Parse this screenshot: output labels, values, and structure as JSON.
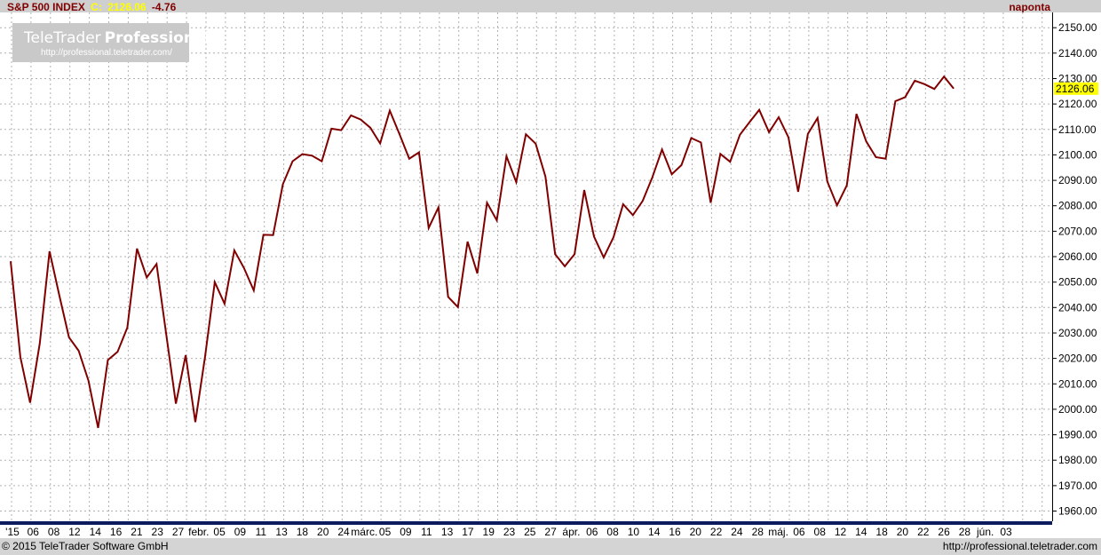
{
  "header": {
    "instrument": "S&P 500 INDEX",
    "close_label": "C:",
    "close_value": "2126.06",
    "change": "-4.76",
    "period": "naponta"
  },
  "watermark": {
    "brand_light": "TeleTrader",
    "brand_bold": "Professional",
    "url": "http://professional.teletrader.com/"
  },
  "footer": {
    "copyright": "© 2015 TeleTrader Software GmbH",
    "url": "http://professional.teletrader.com"
  },
  "colors": {
    "line": "#800000",
    "grid": "#b0b0b0",
    "axis_bar": "#0b1b5e",
    "current_bg": "#ffff00",
    "header_title": "#800000",
    "header_value": "#ffff00",
    "header_change": "#800000"
  },
  "chart_data": {
    "type": "line",
    "title": "S&P 500 INDEX",
    "current_value_label": "2126.06",
    "ylim": [
      1956,
      2156
    ],
    "yticks": [
      "1960.00",
      "1970.00",
      "1980.00",
      "1990.00",
      "2000.00",
      "2010.00",
      "2020.00",
      "2030.00",
      "2040.00",
      "2050.00",
      "2060.00",
      "2070.00",
      "2080.00",
      "2090.00",
      "2100.00",
      "2110.00",
      "2120.00",
      "2130.00",
      "2140.00",
      "2150.00"
    ],
    "x_tick_labels": [
      "'15",
      "06",
      "08",
      "12",
      "14",
      "16",
      "21",
      "23",
      "27",
      "febr.",
      "05",
      "09",
      "11",
      "13",
      "18",
      "20",
      "24",
      "márc.",
      "05",
      "09",
      "11",
      "13",
      "17",
      "19",
      "23",
      "25",
      "27",
      "ápr.",
      "06",
      "08",
      "10",
      "14",
      "16",
      "20",
      "22",
      "24",
      "28",
      "máj.",
      "06",
      "08",
      "12",
      "14",
      "18",
      "20",
      "22",
      "26",
      "28",
      "jún.",
      "03"
    ],
    "grid": true,
    "series": [
      {
        "values": [
          2058.2,
          2020.6,
          2002.6,
          2025.9,
          2062.1,
          2044.8,
          2028.3,
          2023.0,
          2011.3,
          1992.7,
          2019.4,
          2022.6,
          2032.1,
          2063.2,
          2051.8,
          2057.1,
          2029.5,
          2002.2,
          2021.3,
          1995.0,
          2020.8,
          2050.0,
          2041.5,
          2062.5,
          2055.5,
          2046.7,
          2068.6,
          2068.5,
          2088.5,
          2097.5,
          2100.3,
          2099.7,
          2097.5,
          2110.3,
          2109.7,
          2115.5,
          2113.9,
          2110.7,
          2104.5,
          2117.4,
          2108.1,
          2098.5,
          2101.0,
          2071.3,
          2079.4,
          2044.2,
          2040.2,
          2065.9,
          2053.4,
          2081.2,
          2074.3,
          2099.5,
          2089.3,
          2108.1,
          2104.4,
          2091.5,
          2061.0,
          2056.2,
          2061.0,
          2086.2,
          2067.9,
          2059.7,
          2067.6,
          2080.6,
          2076.3,
          2081.9,
          2091.2,
          2102.1,
          2092.4,
          2096.0,
          2106.6,
          2104.9,
          2081.2,
          2100.4,
          2097.3,
          2107.9,
          2112.9,
          2117.7,
          2108.9,
          2114.8,
          2106.9,
          2085.5,
          2108.3,
          2114.5,
          2089.5,
          2080.2,
          2088.0,
          2116.1,
          2105.3,
          2099.1,
          2098.5,
          2121.1,
          2122.7,
          2129.2,
          2127.8,
          2125.9,
          2130.8,
          2126.06
        ]
      }
    ]
  }
}
